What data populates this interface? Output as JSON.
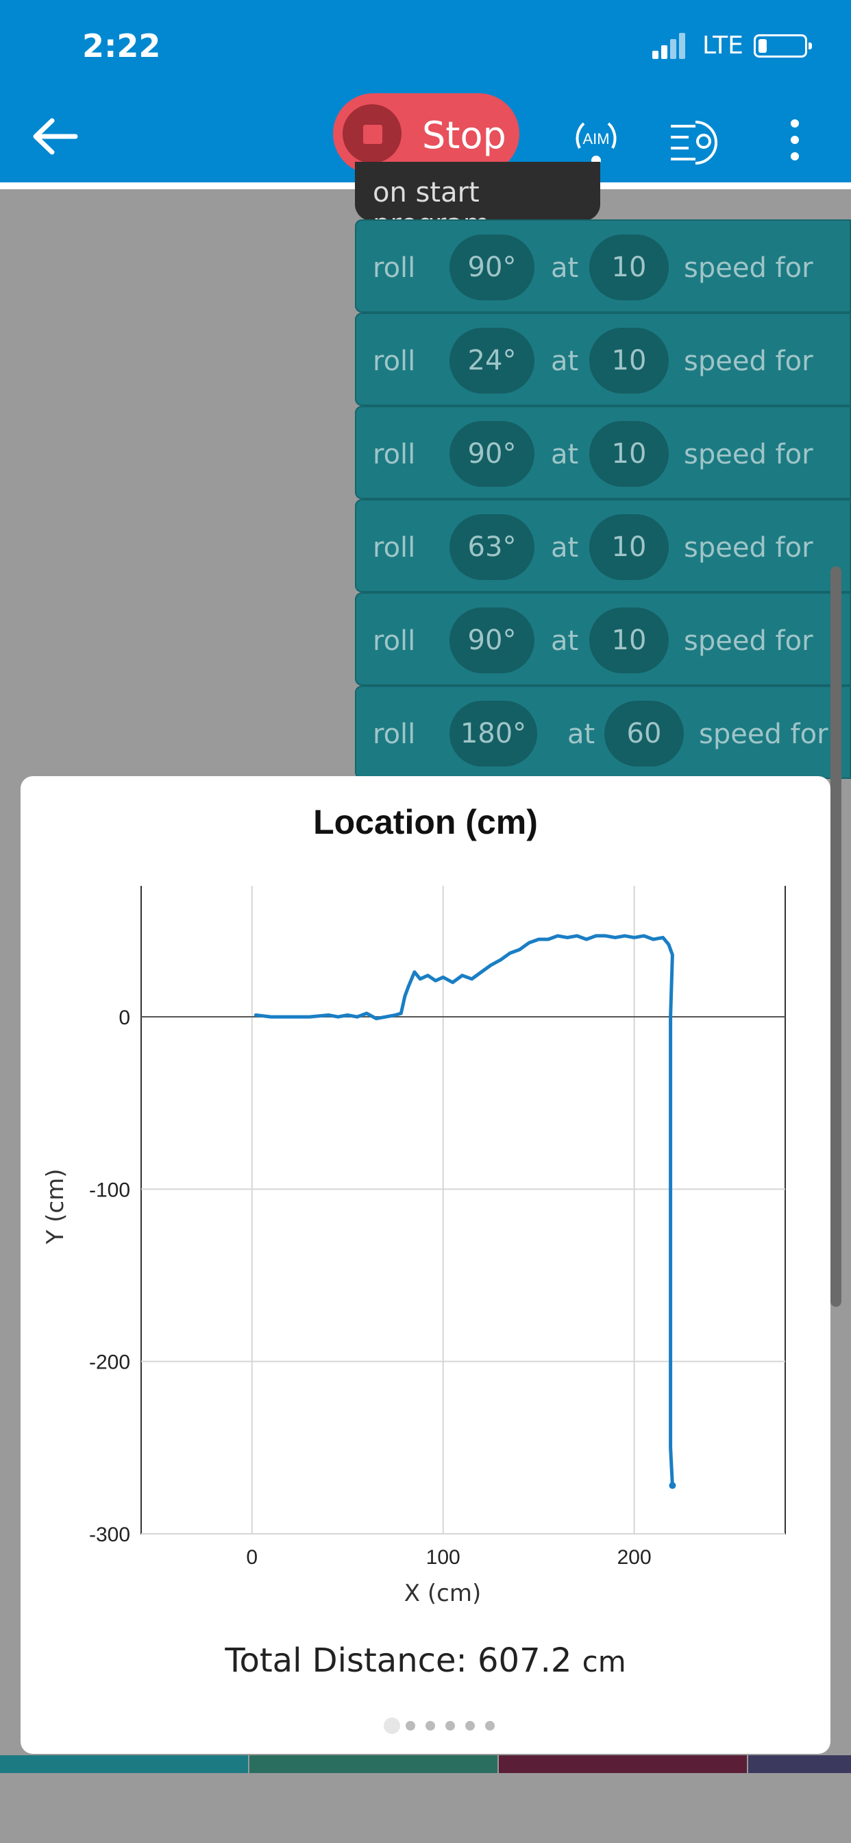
{
  "status_bar": {
    "time": "2:22",
    "network": "LTE",
    "signal_icon": "signal-icon",
    "battery_icon": "battery-icon"
  },
  "toolbar": {
    "back_icon": "arrow-left-icon",
    "stop_label": "Stop",
    "stop_icon": "stop-icon",
    "aim_label": "AIM",
    "sensor_icon": "sensor-lines-icon",
    "more_icon": "more-vert-icon"
  },
  "program": {
    "start_label": "on start program",
    "blocks": [
      {
        "cmd": "roll",
        "heading": "90°",
        "at": "at",
        "speed": "10",
        "suffix": "speed for"
      },
      {
        "cmd": "roll",
        "heading": "24°",
        "at": "at",
        "speed": "10",
        "suffix": "speed for"
      },
      {
        "cmd": "roll",
        "heading": "90°",
        "at": "at",
        "speed": "10",
        "suffix": "speed for"
      },
      {
        "cmd": "roll",
        "heading": "63°",
        "at": "at",
        "speed": "10",
        "suffix": "speed for"
      },
      {
        "cmd": "roll",
        "heading": "90°",
        "at": "at",
        "speed": "10",
        "suffix": "speed for"
      },
      {
        "cmd": "roll",
        "heading": "180°",
        "at": "at",
        "speed": "60",
        "suffix": "speed for"
      }
    ]
  },
  "modal": {
    "title": "Location (cm)",
    "total_label": "Total Distance: 607.2",
    "total_unit": "cm",
    "page_count": 6,
    "active_page": 0
  },
  "chart_data": {
    "type": "line",
    "title": "Location (cm)",
    "xlabel": "X (cm)",
    "ylabel": "Y (cm)",
    "xlim": [
      -58,
      279
    ],
    "ylim": [
      -300,
      80
    ],
    "xticks": [
      0,
      100,
      200
    ],
    "yticks": [
      0,
      -100,
      -200,
      -300
    ],
    "grid": true,
    "series": [
      {
        "color": "#1a7ec4",
        "x": [
          2,
          10,
          20,
          30,
          40,
          45,
          50,
          55,
          60,
          65,
          70,
          75,
          78,
          80,
          82,
          85,
          88,
          92,
          96,
          100,
          105,
          110,
          115,
          120,
          125,
          130,
          135,
          140,
          145,
          150,
          155,
          160,
          165,
          170,
          175,
          180,
          185,
          190,
          195,
          200,
          205,
          210,
          215,
          218,
          220,
          219,
          219,
          219,
          220
        ],
        "y": [
          1,
          0,
          0,
          0,
          1,
          0,
          1,
          0,
          2,
          -1,
          0,
          1,
          2,
          12,
          18,
          26,
          22,
          24,
          21,
          23,
          20,
          24,
          22,
          26,
          30,
          33,
          37,
          39,
          43,
          45,
          45,
          47,
          46,
          47,
          45,
          47,
          47,
          46,
          47,
          46,
          47,
          45,
          46,
          42,
          36,
          0,
          -100,
          -250,
          -272
        ]
      }
    ]
  },
  "colors": {
    "primary": "#0288d1",
    "stop": "#e8505b",
    "block": "#1c7a82",
    "line": "#1a7ec4"
  }
}
